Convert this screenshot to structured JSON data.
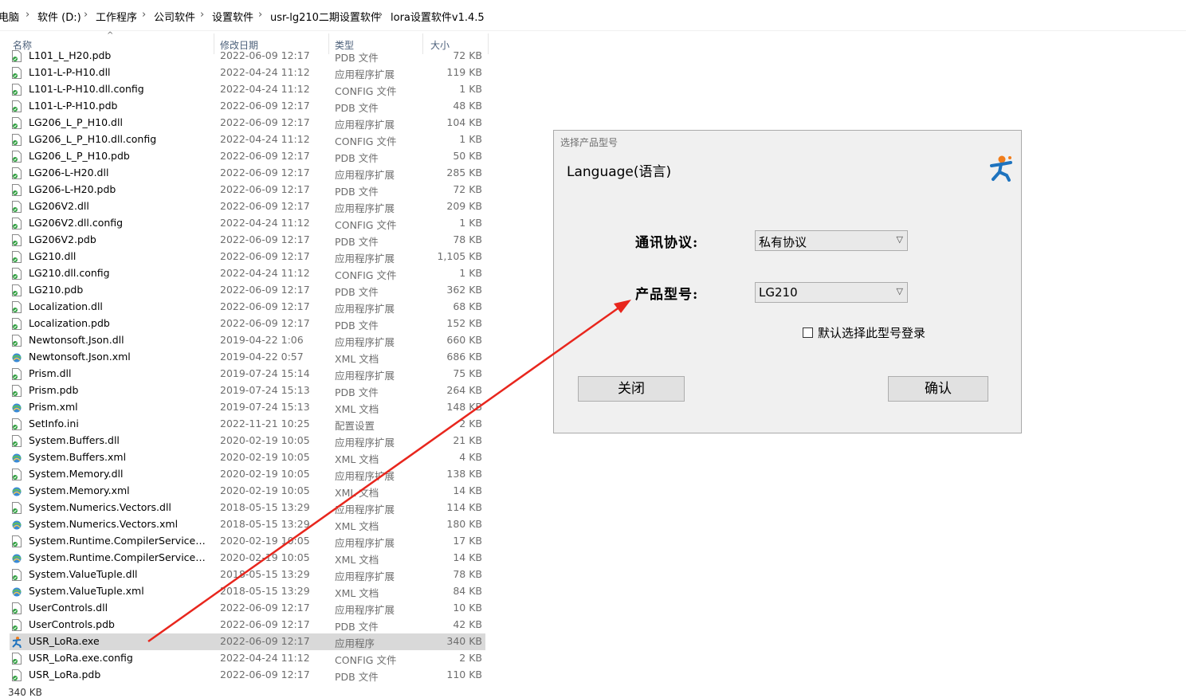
{
  "breadcrumb": [
    "电脑",
    "软件 (D:)",
    "工作程序",
    "公司软件",
    "设置软件",
    "usr-lg210二期设置软件",
    "lora设置软件v1.4.5"
  ],
  "columns": {
    "name": "名称",
    "date": "修改日期",
    "type": "类型",
    "size": "大小"
  },
  "files": [
    {
      "name": "L101_L_H20.pdb",
      "date": "2022-06-09 12:17",
      "type": "PDB 文件",
      "size": "72 KB",
      "icon": "dll-file-icon"
    },
    {
      "name": "L101-L-P-H10.dll",
      "date": "2022-04-24 11:12",
      "type": "应用程序扩展",
      "size": "119 KB",
      "icon": "dll-file-icon"
    },
    {
      "name": "L101-L-P-H10.dll.config",
      "date": "2022-04-24 11:12",
      "type": "CONFIG 文件",
      "size": "1 KB",
      "icon": "dll-file-icon"
    },
    {
      "name": "L101-L-P-H10.pdb",
      "date": "2022-06-09 12:17",
      "type": "PDB 文件",
      "size": "48 KB",
      "icon": "dll-file-icon"
    },
    {
      "name": "LG206_L_P_H10.dll",
      "date": "2022-06-09 12:17",
      "type": "应用程序扩展",
      "size": "104 KB",
      "icon": "dll-file-icon"
    },
    {
      "name": "LG206_L_P_H10.dll.config",
      "date": "2022-04-24 11:12",
      "type": "CONFIG 文件",
      "size": "1 KB",
      "icon": "dll-file-icon"
    },
    {
      "name": "LG206_L_P_H10.pdb",
      "date": "2022-06-09 12:17",
      "type": "PDB 文件",
      "size": "50 KB",
      "icon": "dll-file-icon"
    },
    {
      "name": "LG206-L-H20.dll",
      "date": "2022-06-09 12:17",
      "type": "应用程序扩展",
      "size": "285 KB",
      "icon": "dll-file-icon"
    },
    {
      "name": "LG206-L-H20.pdb",
      "date": "2022-06-09 12:17",
      "type": "PDB 文件",
      "size": "72 KB",
      "icon": "dll-file-icon"
    },
    {
      "name": "LG206V2.dll",
      "date": "2022-06-09 12:17",
      "type": "应用程序扩展",
      "size": "209 KB",
      "icon": "dll-file-icon"
    },
    {
      "name": "LG206V2.dll.config",
      "date": "2022-04-24 11:12",
      "type": "CONFIG 文件",
      "size": "1 KB",
      "icon": "dll-file-icon"
    },
    {
      "name": "LG206V2.pdb",
      "date": "2022-06-09 12:17",
      "type": "PDB 文件",
      "size": "78 KB",
      "icon": "dll-file-icon"
    },
    {
      "name": "LG210.dll",
      "date": "2022-06-09 12:17",
      "type": "应用程序扩展",
      "size": "1,105 KB",
      "icon": "dll-file-icon"
    },
    {
      "name": "LG210.dll.config",
      "date": "2022-04-24 11:12",
      "type": "CONFIG 文件",
      "size": "1 KB",
      "icon": "dll-file-icon"
    },
    {
      "name": "LG210.pdb",
      "date": "2022-06-09 12:17",
      "type": "PDB 文件",
      "size": "362 KB",
      "icon": "dll-file-icon"
    },
    {
      "name": "Localization.dll",
      "date": "2022-06-09 12:17",
      "type": "应用程序扩展",
      "size": "68 KB",
      "icon": "dll-file-icon"
    },
    {
      "name": "Localization.pdb",
      "date": "2022-06-09 12:17",
      "type": "PDB 文件",
      "size": "152 KB",
      "icon": "dll-file-icon"
    },
    {
      "name": "Newtonsoft.Json.dll",
      "date": "2019-04-22 1:06",
      "type": "应用程序扩展",
      "size": "660 KB",
      "icon": "dll-file-icon"
    },
    {
      "name": "Newtonsoft.Json.xml",
      "date": "2019-04-22 0:57",
      "type": "XML 文档",
      "size": "686 KB",
      "icon": "xml-file-icon"
    },
    {
      "name": "Prism.dll",
      "date": "2019-07-24 15:14",
      "type": "应用程序扩展",
      "size": "75 KB",
      "icon": "dll-file-icon"
    },
    {
      "name": "Prism.pdb",
      "date": "2019-07-24 15:13",
      "type": "PDB 文件",
      "size": "264 KB",
      "icon": "dll-file-icon"
    },
    {
      "name": "Prism.xml",
      "date": "2019-07-24 15:13",
      "type": "XML 文档",
      "size": "148 KB",
      "icon": "xml-file-icon"
    },
    {
      "name": "SetInfo.ini",
      "date": "2022-11-21 10:25",
      "type": "配置设置",
      "size": "2 KB",
      "icon": "ini-file-icon"
    },
    {
      "name": "System.Buffers.dll",
      "date": "2020-02-19 10:05",
      "type": "应用程序扩展",
      "size": "21 KB",
      "icon": "dll-file-icon"
    },
    {
      "name": "System.Buffers.xml",
      "date": "2020-02-19 10:05",
      "type": "XML 文档",
      "size": "4 KB",
      "icon": "xml-file-icon"
    },
    {
      "name": "System.Memory.dll",
      "date": "2020-02-19 10:05",
      "type": "应用程序扩展",
      "size": "138 KB",
      "icon": "dll-file-icon"
    },
    {
      "name": "System.Memory.xml",
      "date": "2020-02-19 10:05",
      "type": "XML 文档",
      "size": "14 KB",
      "icon": "xml-file-icon"
    },
    {
      "name": "System.Numerics.Vectors.dll",
      "date": "2018-05-15 13:29",
      "type": "应用程序扩展",
      "size": "114 KB",
      "icon": "dll-file-icon"
    },
    {
      "name": "System.Numerics.Vectors.xml",
      "date": "2018-05-15 13:29",
      "type": "XML 文档",
      "size": "180 KB",
      "icon": "xml-file-icon"
    },
    {
      "name": "System.Runtime.CompilerServices.Un...",
      "date": "2020-02-19 10:05",
      "type": "应用程序扩展",
      "size": "17 KB",
      "icon": "dll-file-icon"
    },
    {
      "name": "System.Runtime.CompilerServices.Un...",
      "date": "2020-02-19 10:05",
      "type": "XML 文档",
      "size": "14 KB",
      "icon": "xml-file-icon"
    },
    {
      "name": "System.ValueTuple.dll",
      "date": "2018-05-15 13:29",
      "type": "应用程序扩展",
      "size": "78 KB",
      "icon": "dll-file-icon"
    },
    {
      "name": "System.ValueTuple.xml",
      "date": "2018-05-15 13:29",
      "type": "XML 文档",
      "size": "84 KB",
      "icon": "xml-file-icon"
    },
    {
      "name": "UserControls.dll",
      "date": "2022-06-09 12:17",
      "type": "应用程序扩展",
      "size": "10 KB",
      "icon": "dll-file-icon"
    },
    {
      "name": "UserControls.pdb",
      "date": "2022-06-09 12:17",
      "type": "PDB 文件",
      "size": "42 KB",
      "icon": "dll-file-icon"
    },
    {
      "name": "USR_LoRa.exe",
      "date": "2022-06-09 12:17",
      "type": "应用程序",
      "size": "340 KB",
      "icon": "exe-app-icon",
      "selected": true
    },
    {
      "name": "USR_LoRa.exe.config",
      "date": "2022-04-24 11:12",
      "type": "CONFIG 文件",
      "size": "2 KB",
      "icon": "dll-file-icon"
    },
    {
      "name": "USR_LoRa.pdb",
      "date": "2022-06-09 12:17",
      "type": "PDB 文件",
      "size": "110 KB",
      "icon": "dll-file-icon"
    }
  ],
  "status_bar": {
    "selected_size": "340 KB"
  },
  "dialog": {
    "title": "选择产品型号",
    "language_label": "Language(语言)",
    "protocol_label": "通讯协议:",
    "protocol_value": "私有协议",
    "model_label": "产品型号:",
    "model_value": "LG210",
    "remember_label": "默认选择此型号登录",
    "remember_checked": false,
    "close_label": "关闭",
    "confirm_label": "确认"
  },
  "colors": {
    "annotation_arrow": "#e8261d",
    "selected_row": "#d9d9d9",
    "dialog_bg": "#f0f0f0"
  }
}
